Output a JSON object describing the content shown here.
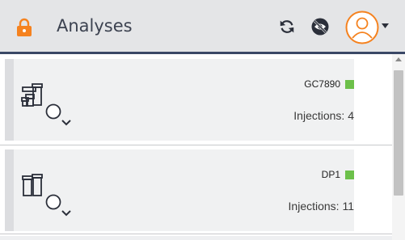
{
  "header": {
    "title": "Analyses",
    "lock_icon": "lock-icon",
    "refresh_icon": "refresh-icon",
    "visibility_icon": "eye-off-icon",
    "avatar_icon": "user-avatar-icon",
    "accent_color": "#f5821f"
  },
  "analyses": [
    {
      "instrument": "GC7890",
      "status_color": "#6cc04a",
      "injections_label": "Injections: 4"
    },
    {
      "instrument": "DP1",
      "status_color": "#6cc04a",
      "injections_label": "Injections: 11"
    }
  ]
}
